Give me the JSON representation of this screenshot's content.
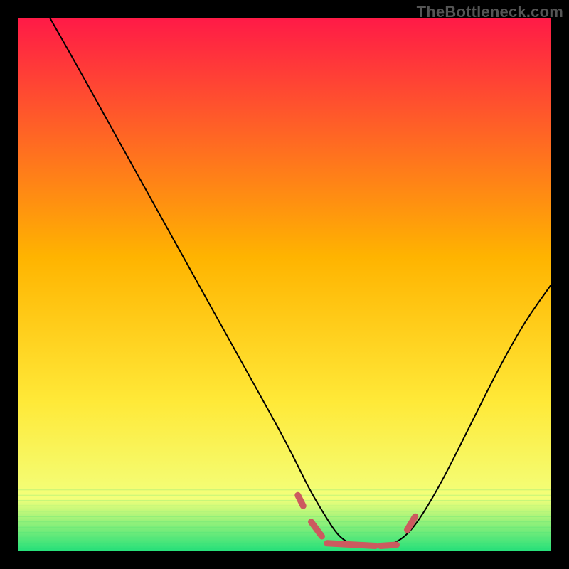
{
  "watermark": "TheBottleneck.com",
  "chart_data": {
    "type": "line",
    "title": "",
    "xlabel": "",
    "ylabel": "",
    "xlim": [
      0,
      100
    ],
    "ylim": [
      0,
      100
    ],
    "gradient_top_color": "#ff1a47",
    "gradient_mid_color": "#ffd400",
    "gradient_low_color": "#f7ff66",
    "gradient_bottom_color": "#24e07a",
    "black_border_px": 25,
    "series": [
      {
        "name": "bottleneck-curve",
        "stroke": "#000000",
        "stroke_width": 2,
        "x": [
          6,
          10,
          15,
          20,
          25,
          30,
          35,
          40,
          45,
          50,
          53,
          55,
          58,
          60,
          62,
          65,
          68,
          70,
          73,
          76,
          80,
          85,
          90,
          95,
          100
        ],
        "y": [
          100,
          93,
          84,
          75,
          66,
          57,
          48,
          39,
          30,
          21,
          15,
          11,
          6,
          3,
          1.5,
          0.8,
          0.8,
          1.2,
          3,
          7,
          14,
          24,
          34,
          43,
          50
        ]
      },
      {
        "name": "target-zone-markers",
        "stroke": "#cc5a5f",
        "stroke_width": 9,
        "stroke_linecap": "round",
        "segments": [
          {
            "x": [
              52.5,
              53.5
            ],
            "y": [
              10.5,
              8.5
            ]
          },
          {
            "x": [
              55.0,
              57.0
            ],
            "y": [
              5.5,
              2.8
            ]
          },
          {
            "x": [
              58.0,
              67.0
            ],
            "y": [
              1.5,
              1.0
            ]
          },
          {
            "x": [
              68.0,
              71.0
            ],
            "y": [
              1.0,
              1.2
            ]
          },
          {
            "x": [
              73.0,
              74.5
            ],
            "y": [
              4.0,
              6.5
            ]
          }
        ]
      }
    ]
  }
}
